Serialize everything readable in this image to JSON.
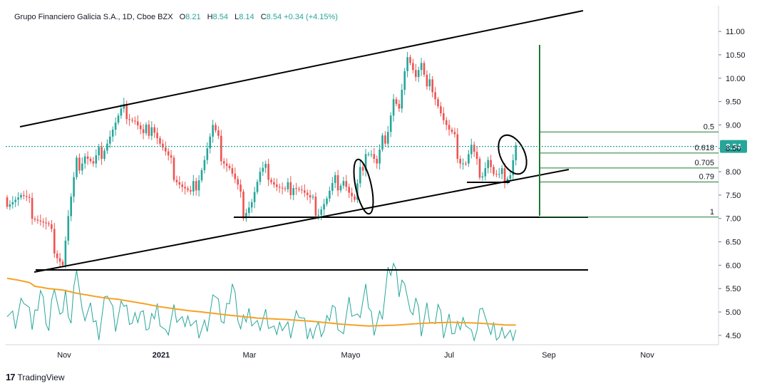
{
  "header": {
    "symbol_line": "Grupo Financiero Galicia S.A., 1D, Cboe BZX",
    "open_label": "O",
    "open": "8.21",
    "high_label": "H",
    "high": "8.54",
    "low_label": "L",
    "low": "8.14",
    "close_label": "C",
    "close": "8.54",
    "change": "+0.34 (+4.15%)"
  },
  "brand": {
    "logo": "17",
    "name": "TradingView"
  },
  "colors": {
    "up": "#26a69a",
    "down": "#ef5350",
    "ma": "#f7a125",
    "volume": "#26a69a",
    "fib": "#1e7a33",
    "price_tag": "#26a69a"
  },
  "chart_data": {
    "type": "candlestick",
    "ylim": [
      4.3,
      11.55
    ],
    "y_ticks": [
      "11.00",
      "10.50",
      "10.00",
      "9.50",
      "9.00",
      "8.50",
      "8.00",
      "7.50",
      "7.00",
      "6.50",
      "6.00",
      "5.50",
      "5.00",
      "4.50"
    ],
    "y_tick_values": [
      11.0,
      10.5,
      10.0,
      9.5,
      9.0,
      8.5,
      8.0,
      7.5,
      7.0,
      6.5,
      6.0,
      5.5,
      5.0,
      4.5
    ],
    "x_labels": [
      "Nov",
      "2021",
      "Mar",
      "Mayo",
      "Jul",
      "Sep",
      "Nov"
    ],
    "x_label_bold": [
      false,
      true,
      false,
      false,
      false,
      false,
      false
    ],
    "last_price": "8.54",
    "last_price_value": 8.54,
    "price_path": [
      [
        0,
        7.45
      ],
      [
        5,
        7.45
      ],
      [
        10,
        7.1
      ],
      [
        15,
        6.75
      ],
      [
        18,
        6.3
      ],
      [
        20,
        6.05
      ],
      [
        22,
        7.0
      ],
      [
        25,
        8.1
      ],
      [
        28,
        8.4
      ],
      [
        31,
        8.1
      ],
      [
        35,
        8.6
      ],
      [
        38,
        8.9
      ],
      [
        41,
        9.2
      ],
      [
        43,
        9.3
      ],
      [
        46,
        9.1
      ],
      [
        49,
        8.7
      ],
      [
        52,
        9.1
      ],
      [
        55,
        8.6
      ],
      [
        58,
        8.2
      ],
      [
        60,
        8.0
      ],
      [
        63,
        7.7
      ],
      [
        66,
        7.45
      ],
      [
        68,
        7.8
      ],
      [
        71,
        8.3
      ],
      [
        74,
        8.9
      ],
      [
        77,
        8.4
      ],
      [
        80,
        8.1
      ],
      [
        83,
        7.6
      ],
      [
        85,
        7.2
      ],
      [
        88,
        7.4
      ],
      [
        91,
        7.9
      ],
      [
        94,
        8.0
      ],
      [
        97,
        7.7
      ],
      [
        100,
        7.5
      ],
      [
        103,
        7.8
      ],
      [
        106,
        7.6
      ],
      [
        109,
        7.3
      ],
      [
        112,
        7.2
      ],
      [
        115,
        7.4
      ],
      [
        118,
        7.75
      ],
      [
        121,
        7.9
      ],
      [
        123,
        7.55
      ],
      [
        125,
        7.3
      ],
      [
        127,
        7.9
      ],
      [
        129,
        8.5
      ],
      [
        131,
        8.4
      ],
      [
        133,
        8.1
      ],
      [
        135,
        8.6
      ],
      [
        137,
        9.0
      ],
      [
        139,
        9.6
      ],
      [
        141,
        9.3
      ],
      [
        143,
        10.0
      ],
      [
        145,
        10.5
      ],
      [
        147,
        10.1
      ],
      [
        149,
        10.3
      ],
      [
        151,
        9.7
      ],
      [
        153,
        9.9
      ],
      [
        155,
        9.5
      ],
      [
        157,
        9.1
      ],
      [
        159,
        8.8
      ],
      [
        161,
        8.6
      ],
      [
        163,
        8.3
      ],
      [
        165,
        8.2
      ],
      [
        167,
        8.5
      ],
      [
        169,
        8.1
      ],
      [
        171,
        8.05
      ],
      [
        173,
        8.3
      ],
      [
        175,
        7.9
      ],
      [
        177,
        7.8
      ],
      [
        179,
        7.95
      ],
      [
        181,
        8.0
      ],
      [
        183,
        8.54
      ]
    ],
    "ma_path": [
      [
        0,
        5.72
      ],
      [
        4,
        5.68
      ],
      [
        8,
        5.63
      ],
      [
        10,
        5.55
      ],
      [
        15,
        5.5
      ],
      [
        20,
        5.47
      ],
      [
        25,
        5.4
      ],
      [
        30,
        5.35
      ],
      [
        35,
        5.3
      ],
      [
        40,
        5.27
      ],
      [
        45,
        5.22
      ],
      [
        50,
        5.17
      ],
      [
        55,
        5.11
      ],
      [
        60,
        5.07
      ],
      [
        65,
        5.03
      ],
      [
        70,
        5.0
      ],
      [
        80,
        4.93
      ],
      [
        90,
        4.87
      ],
      [
        100,
        4.84
      ],
      [
        110,
        4.8
      ],
      [
        120,
        4.74
      ],
      [
        130,
        4.7
      ],
      [
        140,
        4.72
      ],
      [
        150,
        4.76
      ],
      [
        160,
        4.78
      ],
      [
        170,
        4.76
      ],
      [
        180,
        4.72
      ],
      [
        183,
        4.72
      ]
    ],
    "volume_path": [
      [
        0,
        5.1
      ],
      [
        3,
        4.8
      ],
      [
        6,
        5.3
      ],
      [
        9,
        4.7
      ],
      [
        12,
        5.5
      ],
      [
        15,
        4.6
      ],
      [
        17,
        5.6
      ],
      [
        19,
        4.75
      ],
      [
        21,
        5.4
      ],
      [
        23,
        4.8
      ],
      [
        25,
        6.05
      ],
      [
        27,
        4.9
      ],
      [
        30,
        5.0
      ],
      [
        33,
        4.6
      ],
      [
        36,
        5.5
      ],
      [
        39,
        4.7
      ],
      [
        42,
        5.2
      ],
      [
        45,
        4.8
      ],
      [
        48,
        5.0
      ],
      [
        51,
        4.6
      ],
      [
        54,
        5.1
      ],
      [
        57,
        4.5
      ],
      [
        60,
        5.0
      ],
      [
        63,
        4.7
      ],
      [
        66,
        4.9
      ],
      [
        69,
        4.6
      ],
      [
        72,
        4.7
      ],
      [
        75,
        5.4
      ],
      [
        78,
        4.8
      ],
      [
        81,
        5.6
      ],
      [
        84,
        4.6
      ],
      [
        87,
        5.0
      ],
      [
        90,
        4.7
      ],
      [
        93,
        4.9
      ],
      [
        96,
        4.5
      ],
      [
        99,
        4.8
      ],
      [
        102,
        4.6
      ],
      [
        105,
        5.0
      ],
      [
        108,
        4.5
      ],
      [
        111,
        4.7
      ],
      [
        114,
        4.6
      ],
      [
        117,
        5.1
      ],
      [
        120,
        4.5
      ],
      [
        123,
        5.2
      ],
      [
        126,
        4.8
      ],
      [
        129,
        5.4
      ],
      [
        132,
        4.7
      ],
      [
        135,
        5.0
      ],
      [
        137,
        5.8
      ],
      [
        139,
        6.0
      ],
      [
        141,
        5.4
      ],
      [
        143,
        5.8
      ],
      [
        145,
        4.9
      ],
      [
        147,
        5.3
      ],
      [
        149,
        4.6
      ],
      [
        151,
        5.0
      ],
      [
        153,
        4.7
      ],
      [
        155,
        5.2
      ],
      [
        157,
        4.6
      ],
      [
        159,
        4.8
      ],
      [
        161,
        4.5
      ],
      [
        163,
        4.7
      ],
      [
        165,
        4.9
      ],
      [
        167,
        4.5
      ],
      [
        169,
        4.6
      ],
      [
        171,
        5.2
      ],
      [
        173,
        4.5
      ],
      [
        175,
        4.7
      ],
      [
        177,
        4.5
      ],
      [
        179,
        4.6
      ],
      [
        181,
        4.45
      ],
      [
        183,
        4.58
      ]
    ],
    "fib_labels": [
      "0.5",
      "0.618",
      "0.705",
      "0.79",
      "1"
    ],
    "fib_values": [
      8.85,
      8.4,
      8.08,
      7.78,
      7.03
    ]
  }
}
